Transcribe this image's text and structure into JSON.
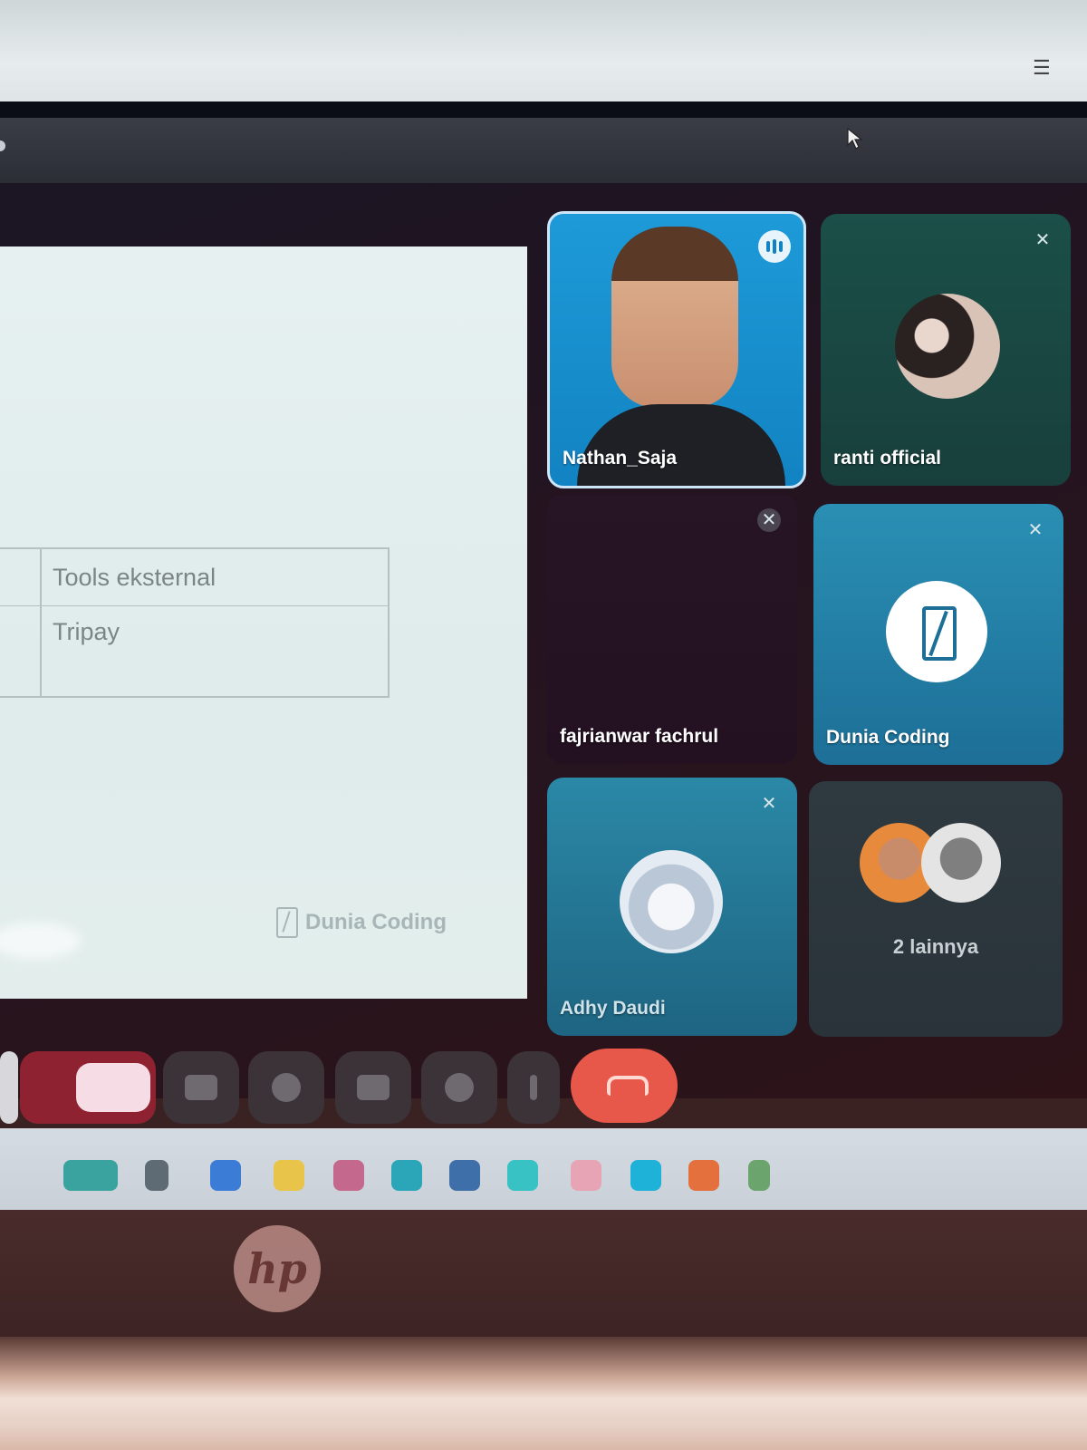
{
  "slide": {
    "table_rows": [
      "Tools eksternal",
      "Tripay"
    ],
    "watermark": "Dunia Coding"
  },
  "participants": [
    {
      "name": "Nathan_Saja",
      "state": "speaking",
      "icon": "speaking-icon"
    },
    {
      "name": "ranti official",
      "state": "muted",
      "icon": "mic-off-icon"
    },
    {
      "name": "fajrianwar fachrul",
      "state": "muted",
      "icon": "mic-off-icon"
    },
    {
      "name": "Dunia Coding",
      "state": "muted",
      "icon": "mic-off-icon"
    },
    {
      "name": "Adhy Daudi",
      "state": "muted",
      "icon": "mic-off-icon"
    },
    {
      "name": "2 lainnya",
      "state": "group",
      "icon": "avatar-group-icon"
    }
  ],
  "controls": [
    {
      "name": "present-button",
      "icon": "present-icon"
    },
    {
      "name": "captions-button",
      "icon": "captions-icon"
    },
    {
      "name": "emoji-button",
      "icon": "emoji-icon"
    },
    {
      "name": "share-screen-button",
      "icon": "share-screen-icon"
    },
    {
      "name": "raise-hand-button",
      "icon": "hand-icon"
    },
    {
      "name": "more-options-button",
      "icon": "more-vert-icon"
    },
    {
      "name": "end-call-button",
      "icon": "phone-hangup-icon"
    }
  ],
  "colors": {
    "end_call": "#e8584a",
    "active_tile": "#1e9ad8",
    "dunia_tile": "#2a8fb4"
  }
}
